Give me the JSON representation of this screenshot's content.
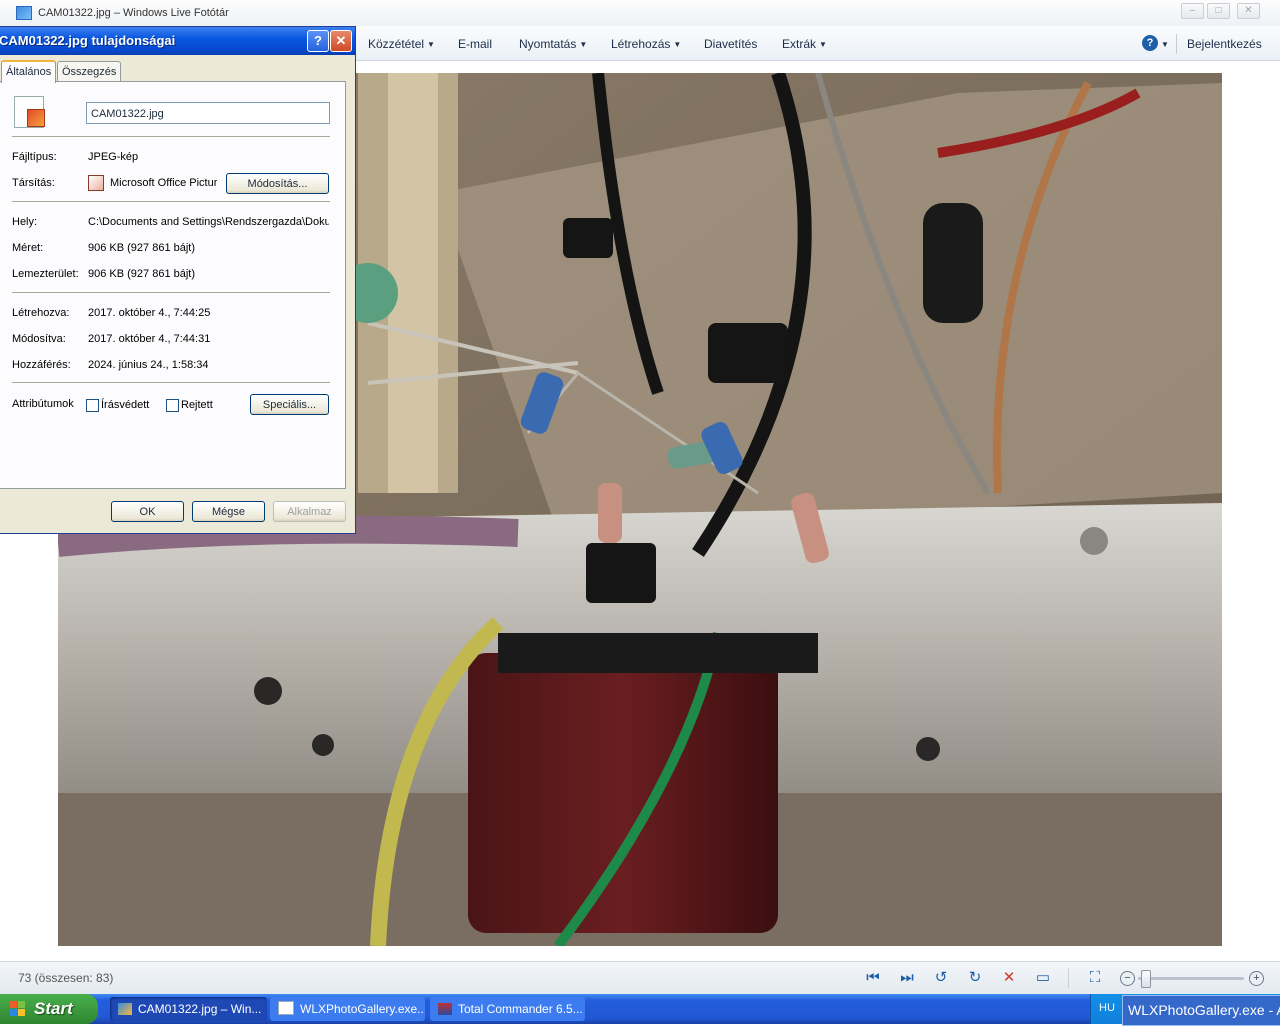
{
  "window": {
    "title": "CAM01322.jpg – Windows Live Fotótár",
    "controls": [
      "–",
      "□",
      "✕"
    ]
  },
  "menu": {
    "items": [
      {
        "label": "Közzététel",
        "dropdown": true
      },
      {
        "label": "E-mail",
        "dropdown": false
      },
      {
        "label": "Nyomtatás",
        "dropdown": true
      },
      {
        "label": "Létrehozás",
        "dropdown": true
      },
      {
        "label": "Diavetítés",
        "dropdown": false
      },
      {
        "label": "Extrák",
        "dropdown": true
      }
    ],
    "help": "?",
    "signin": "Bejelentkezés"
  },
  "status": {
    "count": "73 (összesen: 83)"
  },
  "toolbar_icons": [
    "previous-icon",
    "next-icon",
    "rotate-left-icon",
    "rotate-right-icon",
    "delete-icon",
    "slideshow-icon",
    "actual-size-icon",
    "zoom-out-icon",
    "zoom-in-icon"
  ],
  "toolbar_glyphs": {
    "minus": "−",
    "plus": "+"
  },
  "zoom": {
    "level": 0.02
  },
  "dialog": {
    "title": "CAM01322.jpg tulajdonságai",
    "help": "?",
    "close": "✕",
    "tabs": [
      "Általános",
      "Összegzés"
    ],
    "filename": "CAM01322.jpg",
    "fields": {
      "filetype_label": "Fájltípus:",
      "filetype_value": "JPEG-kép",
      "assoc_label": "Társítás:",
      "assoc_value": "Microsoft Office Pictur",
      "change_button": "Módosítás...",
      "location_label": "Hely:",
      "location_value": "C:\\Documents and Settings\\Rendszergazda\\Dokum",
      "size_label": "Méret:",
      "size_value": "906 KB (927 861 bájt)",
      "disk_label": "Lemezterület:",
      "disk_value": "906 KB (927 861 bájt)",
      "created_label": "Létrehozva:",
      "created_value": "2017. október 4., 7:44:25",
      "modified_label": "Módosítva:",
      "modified_value": "2017. október 4., 7:44:31",
      "accessed_label": "Hozzáférés:",
      "accessed_value": "2024. június 24., 1:58:34",
      "attributes_label": "Attribútumok",
      "readonly_label": "Írásvédett",
      "hidden_label": "Rejtett",
      "advanced_button": "Speciális..."
    },
    "buttons": {
      "ok": "OK",
      "cancel": "Mégse",
      "apply": "Alkalmaz"
    }
  },
  "taskbar": {
    "start": "Start",
    "tasks": [
      {
        "label": "CAM01322.jpg – Win...",
        "active": true
      },
      {
        "label": "WLXPhotoGallery.exe...",
        "active": false
      },
      {
        "label": "Total Commander 6.5...",
        "active": false
      }
    ],
    "lang": "HU",
    "popup": "WLXPhotoGallery.exe - A"
  },
  "colors": {
    "accent": "#1f5fa8",
    "taskbar": "#245edc",
    "start": "#3c9a3e"
  }
}
